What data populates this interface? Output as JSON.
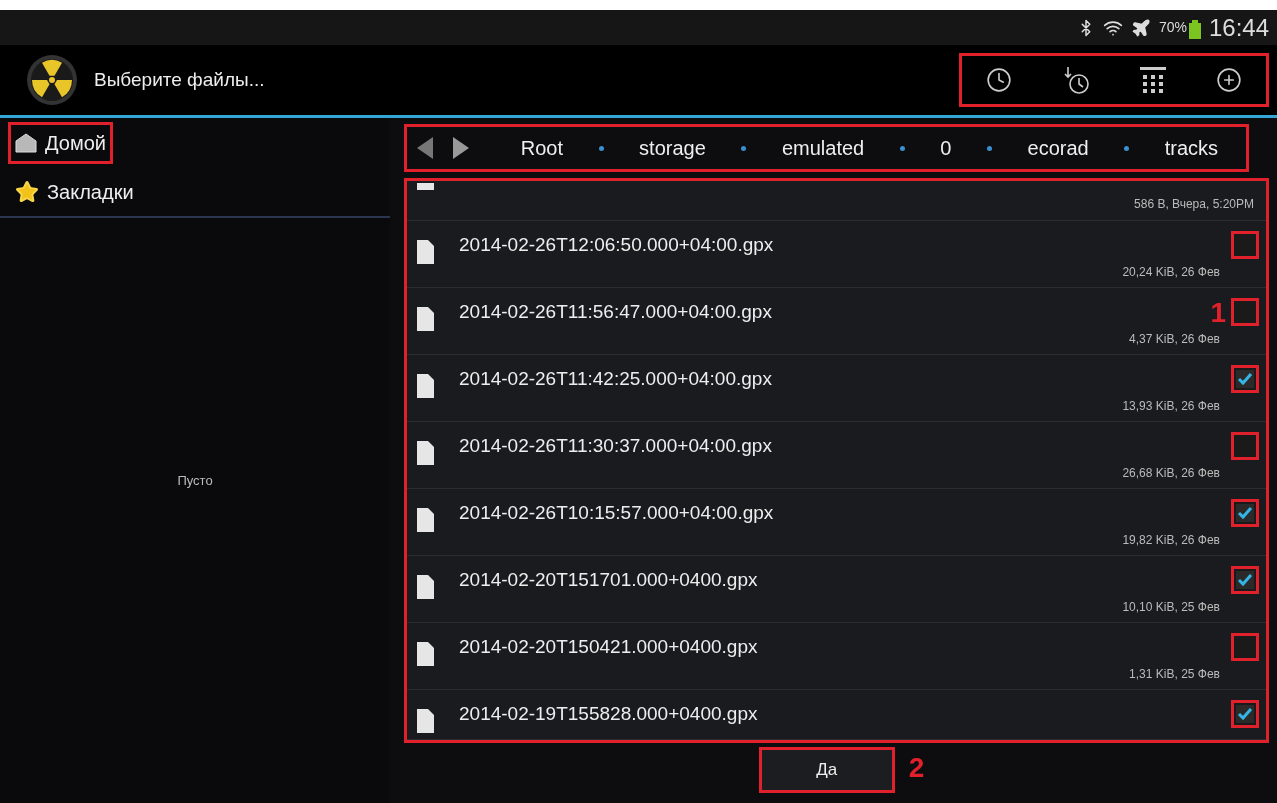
{
  "status_bar": {
    "battery_text": "70%",
    "time": "16:44"
  },
  "action_bar": {
    "title": "Выберите файлы..."
  },
  "sidebar": {
    "items": [
      {
        "label": "Домой",
        "kind": "home",
        "selected": true
      },
      {
        "label": "Закладки",
        "kind": "bookmarks",
        "selected": false
      }
    ],
    "empty_text": "Пусто"
  },
  "breadcrumb": {
    "segments": [
      "Root",
      "storage",
      "emulated",
      "0",
      "ecorad",
      "tracks"
    ]
  },
  "file_list": {
    "rows": [
      {
        "name": "",
        "meta": "586 B, Вчера, 5:20PM",
        "kind": "partial"
      },
      {
        "name": "2014-02-26T12:06:50.000+04:00.gpx",
        "meta": "20,24 KiB, 26 Фев",
        "kind": "file",
        "checked": false
      },
      {
        "name": "2014-02-26T11:56:47.000+04:00.gpx",
        "meta": "4,37 KiB, 26 Фев",
        "kind": "file",
        "checked": false,
        "marker": "1"
      },
      {
        "name": "2014-02-26T11:42:25.000+04:00.gpx",
        "meta": "13,93 KiB, 26 Фев",
        "kind": "file",
        "checked": true
      },
      {
        "name": "2014-02-26T11:30:37.000+04:00.gpx",
        "meta": "26,68 KiB, 26 Фев",
        "kind": "file",
        "checked": false
      },
      {
        "name": "2014-02-26T10:15:57.000+04:00.gpx",
        "meta": "19,82 KiB, 26 Фев",
        "kind": "file",
        "checked": true
      },
      {
        "name": "2014-02-20T151701.000+0400.gpx",
        "meta": "10,10 KiB, 25 Фев",
        "kind": "file",
        "checked": true
      },
      {
        "name": "2014-02-20T150421.000+0400.gpx",
        "meta": "1,31 KiB, 25 Фев",
        "kind": "file",
        "checked": false
      },
      {
        "name": "2014-02-19T155828.000+0400.gpx",
        "kind": "file",
        "checked": true
      }
    ]
  },
  "ok_button": {
    "label": "Да",
    "marker": "2"
  }
}
